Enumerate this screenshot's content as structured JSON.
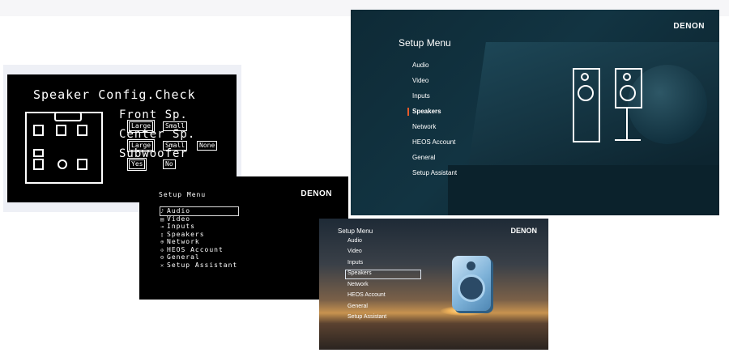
{
  "speaker_config": {
    "title": "Speaker Config.Check",
    "groups": [
      {
        "name": "Front Sp.",
        "options": [
          "Large",
          "Small"
        ],
        "selected": "Large"
      },
      {
        "name": "Center Sp.",
        "options": [
          "Large",
          "Small",
          "None"
        ],
        "selected": "Large"
      },
      {
        "name": "Subwoofer",
        "options": [
          "Yes",
          "No"
        ],
        "selected": "Yes"
      }
    ]
  },
  "menu_dark": {
    "header": "Setup Menu",
    "brand": "DENON",
    "items": [
      "Audio",
      "Video",
      "Inputs",
      "Speakers",
      "Network",
      "HEOS Account",
      "General",
      "Setup Assistant"
    ],
    "selected_index": 0
  },
  "menu_teal": {
    "header": "Setup Menu",
    "brand": "DENON",
    "items": [
      "Audio",
      "Video",
      "Inputs",
      "Speakers",
      "Network",
      "HEOS Account",
      "General",
      "Setup Assistant"
    ],
    "selected_index": 3,
    "accent": "#e85a2a"
  },
  "menu_sunset": {
    "header": "Setup Menu",
    "brand": "DENON",
    "items": [
      "Audio",
      "Video",
      "Inputs",
      "Speakers",
      "Network",
      "HEOS Account",
      "General",
      "Setup Assistant"
    ],
    "selected_index": 3
  }
}
